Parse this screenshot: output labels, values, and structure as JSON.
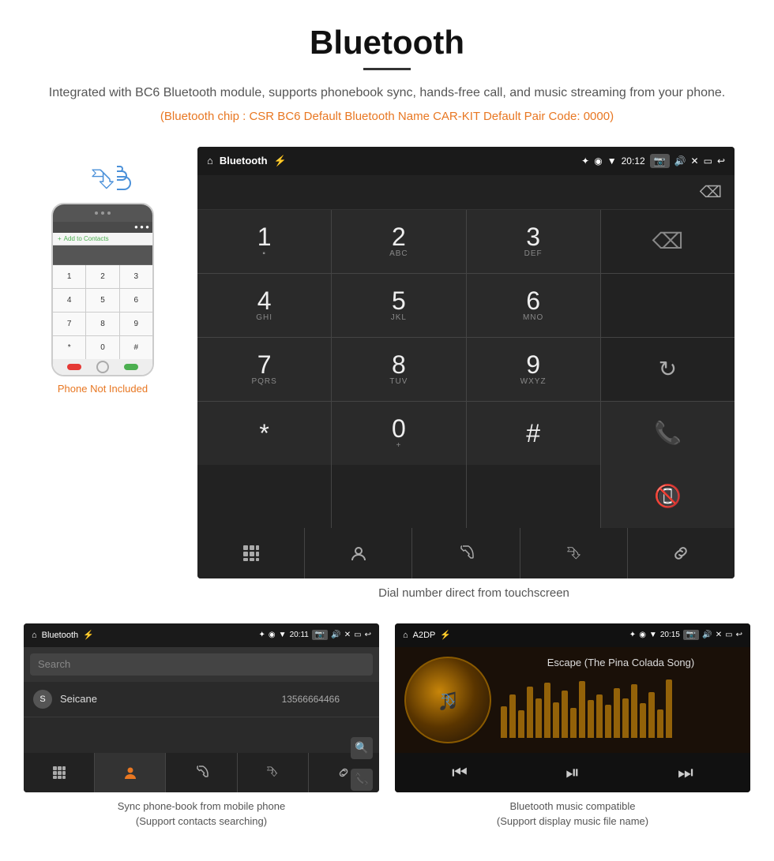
{
  "header": {
    "title": "Bluetooth",
    "description": "Integrated with BC6 Bluetooth module, supports phonebook sync, hands-free call, and music streaming from your phone.",
    "specs": "(Bluetooth chip : CSR BC6    Default Bluetooth Name CAR-KIT    Default Pair Code: 0000)"
  },
  "dial_screen": {
    "status_bar": {
      "title": "Bluetooth",
      "time": "20:12"
    },
    "keys": [
      {
        "num": "1",
        "sub": ""
      },
      {
        "num": "2",
        "sub": "ABC"
      },
      {
        "num": "3",
        "sub": "DEF"
      },
      {
        "num": "4",
        "sub": "GHI"
      },
      {
        "num": "5",
        "sub": "JKL"
      },
      {
        "num": "6",
        "sub": "MNO"
      },
      {
        "num": "7",
        "sub": "PQRS"
      },
      {
        "num": "8",
        "sub": "TUV"
      },
      {
        "num": "9",
        "sub": "WXYZ"
      },
      {
        "num": "*",
        "sub": ""
      },
      {
        "num": "0",
        "sub": "+"
      },
      {
        "num": "#",
        "sub": ""
      }
    ],
    "caption": "Dial number direct from touchscreen"
  },
  "phone_section": {
    "not_included_label": "Phone Not Included"
  },
  "phonebook_screen": {
    "status_bar": {
      "title": "Bluetooth",
      "time": "20:11"
    },
    "search_placeholder": "Search",
    "contact": {
      "initial": "S",
      "name": "Seicane",
      "number": "13566664466"
    },
    "caption_line1": "Sync phone-book from mobile phone",
    "caption_line2": "(Support contacts searching)"
  },
  "music_screen": {
    "status_bar": {
      "title": "A2DP",
      "time": "20:15"
    },
    "song_title": "Escape (The Pina Colada Song)",
    "eq_bars": [
      40,
      55,
      35,
      65,
      50,
      70,
      45,
      60,
      38,
      72,
      48,
      55,
      42,
      63,
      50,
      68,
      44,
      58,
      36,
      74
    ],
    "caption_line1": "Bluetooth music compatible",
    "caption_line2": "(Support display music file name)"
  }
}
